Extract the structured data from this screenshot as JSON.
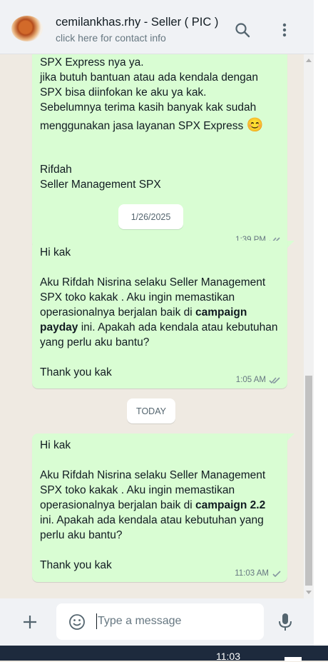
{
  "header": {
    "title": "cemilankhas.rhy - Seller ( PIC )",
    "subtitle": "click here for contact info"
  },
  "messages": [
    {
      "lines": [
        "SPX Express nya ya.",
        "jika butuh bantuan atau ada kendala dengan",
        "SPX bisa diinfokan ke aku ya kak.",
        "Sebelumnya terima kasih banyak kak sudah",
        "menggunakan jasa layanan SPX Express",
        "",
        "",
        "Rifdah",
        "Seller Management SPX"
      ],
      "emoji": "😊",
      "time": "1:39 PM",
      "status": "read"
    },
    {
      "lines": [
        "Hi kak",
        "",
        "Aku Rifdah Nisrina selaku Seller Management",
        "SPX toko kakak . Aku ingin memastikan",
        "operasionalnya berjalan baik di ",
        "payday",
        " ini. Apakah ada kendala atau kebutuhan",
        "yang perlu aku bantu?",
        "",
        "Thank you kak"
      ],
      "bold": [
        "campaign",
        "payday"
      ],
      "time": "1:05 AM",
      "status": "read"
    },
    {
      "lines": [
        "Hi kak",
        "",
        "Aku Rifdah Nisrina selaku Seller Management",
        "SPX toko kakak . Aku ingin memastikan",
        "operasionalnya berjalan baik di ",
        "ini. Apakah ada kendala atau kebutuhan yang",
        "perlu aku bantu?",
        "",
        "Thank you kak"
      ],
      "bold": [
        "campaign 2.2"
      ],
      "time": "11:03 AM",
      "status": "sent"
    }
  ],
  "dates": [
    "1/26/2025",
    "TODAY"
  ],
  "composer": {
    "placeholder": "Type a message"
  },
  "taskbar": {
    "time": "11:03"
  },
  "colors": {
    "outgoing_bubble": "#d9fdd3",
    "chat_bg": "#efeae2",
    "read_ticks": "#667781"
  },
  "icons": [
    "search-icon",
    "menu-icon",
    "plus-icon",
    "emoji-icon",
    "mic-icon",
    "double-check-icon",
    "check-icon"
  ]
}
